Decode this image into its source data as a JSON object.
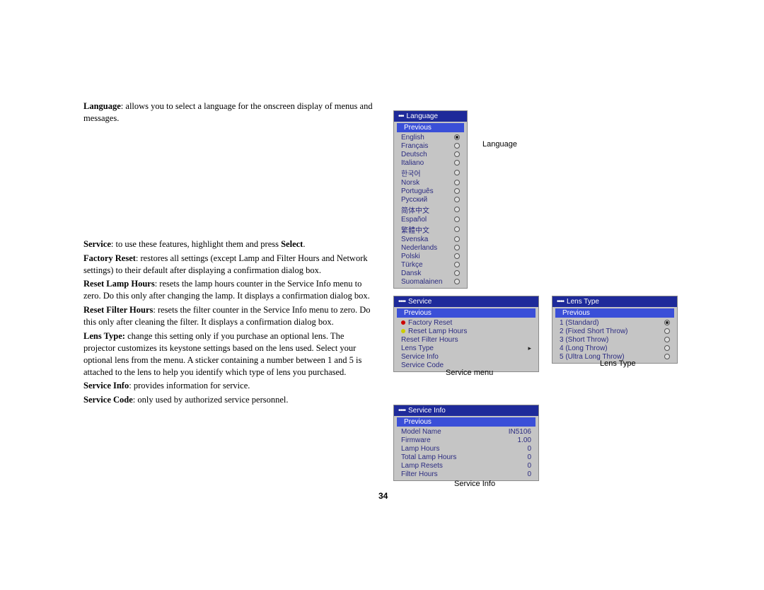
{
  "page_number": "34",
  "text": {
    "lang_b": "Language",
    "lang_t": ": allows you to select a language for the onscreen display of menus and messages.",
    "svc_b": "Service",
    "svc_t": ": to use these features, highlight them and press ",
    "svc_sel": "Select",
    "svc_dot": ".",
    "fr_b": "Factory Reset",
    "fr_t": ": restores all settings (except Lamp and Filter Hours and Network settings) to their default after displaying a confirmation dialog box.",
    "rlh_b": "Reset Lamp Hours",
    "rlh_t": ": resets the lamp hours counter in the Service Info menu to zero. Do this only after changing the lamp. It displays a confirmation dialog box.",
    "rfh_b": "Reset Filter Hours",
    "rfh_t": ": resets the filter counter in the Service Info menu to zero. Do this only after cleaning the filter. It displays a confirmation dialog box.",
    "lt_b": "Lens Type:",
    "lt_t": " change this setting only if you purchase an optional lens. The projector customizes its keystone settings based on the lens used. Select your optional lens from the menu. A sticker containing a number between 1 and 5 is attached to the lens to help you identify which type of lens you purchased.",
    "si_b": "Service Info",
    "si_t": ": provides information for service.",
    "sc_b": "Service Code",
    "sc_t": ": only used by authorized service personnel."
  },
  "captions": {
    "language": "Language",
    "service_menu": "Service menu",
    "lens_type": "Lens Type",
    "service_info": "Service Info"
  },
  "menus": {
    "language": {
      "dots": "•••",
      "title": "Language",
      "previous": "Previous",
      "items": [
        {
          "label": "English",
          "selected": true
        },
        {
          "label": "Français",
          "selected": false
        },
        {
          "label": "Deutsch",
          "selected": false
        },
        {
          "label": "Italiano",
          "selected": false
        },
        {
          "label": "한국어",
          "selected": false
        },
        {
          "label": "Norsk",
          "selected": false
        },
        {
          "label": "Português",
          "selected": false
        },
        {
          "label": "Русский",
          "selected": false
        },
        {
          "label": "简体中文",
          "selected": false
        },
        {
          "label": "Español",
          "selected": false
        },
        {
          "label": "繁體中文",
          "selected": false
        },
        {
          "label": "Svenska",
          "selected": false
        },
        {
          "label": "Nederlands",
          "selected": false
        },
        {
          "label": "Polski",
          "selected": false
        },
        {
          "label": "Türkçe",
          "selected": false
        },
        {
          "label": "Dansk",
          "selected": false
        },
        {
          "label": "Suomalainen",
          "selected": false
        }
      ]
    },
    "service": {
      "dots": "••••",
      "title": "Service",
      "previous": "Previous",
      "items": [
        {
          "label": "Factory Reset",
          "icon": "red"
        },
        {
          "label": "Reset Lamp Hours",
          "icon": "yellow"
        },
        {
          "label": "Reset Filter Hours",
          "icon": ""
        },
        {
          "label": "Lens Type",
          "icon": "",
          "arrow": true
        },
        {
          "label": "Service Info",
          "icon": ""
        },
        {
          "label": "Service Code",
          "icon": ""
        }
      ]
    },
    "lens": {
      "dots": "••••",
      "title": "Lens Type",
      "previous": "Previous",
      "items": [
        {
          "label": "1 (Standard)",
          "selected": true
        },
        {
          "label": "2 (Fixed Short Throw)",
          "selected": false
        },
        {
          "label": "3 (Short Throw)",
          "selected": false
        },
        {
          "label": "4 (Long Throw)",
          "selected": false
        },
        {
          "label": "5 (Ultra Long Throw)",
          "selected": false
        }
      ]
    },
    "info": {
      "dots": "••••",
      "title": "Service Info",
      "previous": "Previous",
      "rows": [
        {
          "label": "Model Name",
          "value": "IN5106"
        },
        {
          "label": "Firmware",
          "value": "1.00"
        },
        {
          "label": "Lamp Hours",
          "value": "0"
        },
        {
          "label": "Total Lamp Hours",
          "value": "0"
        },
        {
          "label": "Lamp Resets",
          "value": "0"
        },
        {
          "label": "Filter Hours",
          "value": "0"
        }
      ]
    }
  }
}
